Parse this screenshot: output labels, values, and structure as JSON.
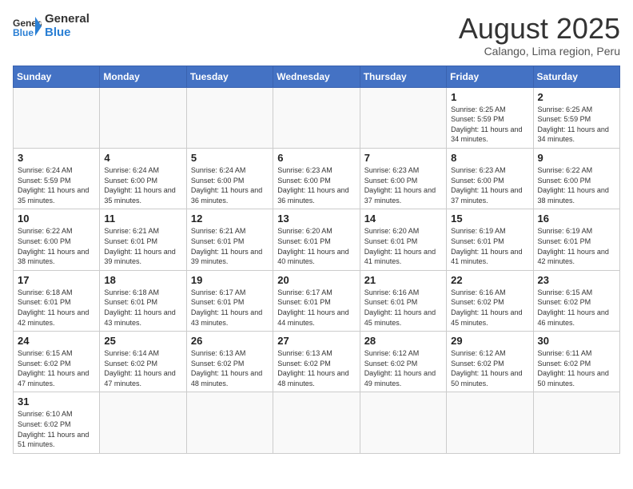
{
  "header": {
    "logo_general": "General",
    "logo_blue": "Blue",
    "month_title": "August 2025",
    "subtitle": "Calango, Lima region, Peru"
  },
  "weekdays": [
    "Sunday",
    "Monday",
    "Tuesday",
    "Wednesday",
    "Thursday",
    "Friday",
    "Saturday"
  ],
  "weeks": [
    [
      {
        "day": "",
        "info": ""
      },
      {
        "day": "",
        "info": ""
      },
      {
        "day": "",
        "info": ""
      },
      {
        "day": "",
        "info": ""
      },
      {
        "day": "",
        "info": ""
      },
      {
        "day": "1",
        "info": "Sunrise: 6:25 AM\nSunset: 5:59 PM\nDaylight: 11 hours and 34 minutes."
      },
      {
        "day": "2",
        "info": "Sunrise: 6:25 AM\nSunset: 5:59 PM\nDaylight: 11 hours and 34 minutes."
      }
    ],
    [
      {
        "day": "3",
        "info": "Sunrise: 6:24 AM\nSunset: 5:59 PM\nDaylight: 11 hours and 35 minutes."
      },
      {
        "day": "4",
        "info": "Sunrise: 6:24 AM\nSunset: 6:00 PM\nDaylight: 11 hours and 35 minutes."
      },
      {
        "day": "5",
        "info": "Sunrise: 6:24 AM\nSunset: 6:00 PM\nDaylight: 11 hours and 36 minutes."
      },
      {
        "day": "6",
        "info": "Sunrise: 6:23 AM\nSunset: 6:00 PM\nDaylight: 11 hours and 36 minutes."
      },
      {
        "day": "7",
        "info": "Sunrise: 6:23 AM\nSunset: 6:00 PM\nDaylight: 11 hours and 37 minutes."
      },
      {
        "day": "8",
        "info": "Sunrise: 6:23 AM\nSunset: 6:00 PM\nDaylight: 11 hours and 37 minutes."
      },
      {
        "day": "9",
        "info": "Sunrise: 6:22 AM\nSunset: 6:00 PM\nDaylight: 11 hours and 38 minutes."
      }
    ],
    [
      {
        "day": "10",
        "info": "Sunrise: 6:22 AM\nSunset: 6:00 PM\nDaylight: 11 hours and 38 minutes."
      },
      {
        "day": "11",
        "info": "Sunrise: 6:21 AM\nSunset: 6:01 PM\nDaylight: 11 hours and 39 minutes."
      },
      {
        "day": "12",
        "info": "Sunrise: 6:21 AM\nSunset: 6:01 PM\nDaylight: 11 hours and 39 minutes."
      },
      {
        "day": "13",
        "info": "Sunrise: 6:20 AM\nSunset: 6:01 PM\nDaylight: 11 hours and 40 minutes."
      },
      {
        "day": "14",
        "info": "Sunrise: 6:20 AM\nSunset: 6:01 PM\nDaylight: 11 hours and 41 minutes."
      },
      {
        "day": "15",
        "info": "Sunrise: 6:19 AM\nSunset: 6:01 PM\nDaylight: 11 hours and 41 minutes."
      },
      {
        "day": "16",
        "info": "Sunrise: 6:19 AM\nSunset: 6:01 PM\nDaylight: 11 hours and 42 minutes."
      }
    ],
    [
      {
        "day": "17",
        "info": "Sunrise: 6:18 AM\nSunset: 6:01 PM\nDaylight: 11 hours and 42 minutes."
      },
      {
        "day": "18",
        "info": "Sunrise: 6:18 AM\nSunset: 6:01 PM\nDaylight: 11 hours and 43 minutes."
      },
      {
        "day": "19",
        "info": "Sunrise: 6:17 AM\nSunset: 6:01 PM\nDaylight: 11 hours and 43 minutes."
      },
      {
        "day": "20",
        "info": "Sunrise: 6:17 AM\nSunset: 6:01 PM\nDaylight: 11 hours and 44 minutes."
      },
      {
        "day": "21",
        "info": "Sunrise: 6:16 AM\nSunset: 6:01 PM\nDaylight: 11 hours and 45 minutes."
      },
      {
        "day": "22",
        "info": "Sunrise: 6:16 AM\nSunset: 6:02 PM\nDaylight: 11 hours and 45 minutes."
      },
      {
        "day": "23",
        "info": "Sunrise: 6:15 AM\nSunset: 6:02 PM\nDaylight: 11 hours and 46 minutes."
      }
    ],
    [
      {
        "day": "24",
        "info": "Sunrise: 6:15 AM\nSunset: 6:02 PM\nDaylight: 11 hours and 47 minutes."
      },
      {
        "day": "25",
        "info": "Sunrise: 6:14 AM\nSunset: 6:02 PM\nDaylight: 11 hours and 47 minutes."
      },
      {
        "day": "26",
        "info": "Sunrise: 6:13 AM\nSunset: 6:02 PM\nDaylight: 11 hours and 48 minutes."
      },
      {
        "day": "27",
        "info": "Sunrise: 6:13 AM\nSunset: 6:02 PM\nDaylight: 11 hours and 48 minutes."
      },
      {
        "day": "28",
        "info": "Sunrise: 6:12 AM\nSunset: 6:02 PM\nDaylight: 11 hours and 49 minutes."
      },
      {
        "day": "29",
        "info": "Sunrise: 6:12 AM\nSunset: 6:02 PM\nDaylight: 11 hours and 50 minutes."
      },
      {
        "day": "30",
        "info": "Sunrise: 6:11 AM\nSunset: 6:02 PM\nDaylight: 11 hours and 50 minutes."
      }
    ],
    [
      {
        "day": "31",
        "info": "Sunrise: 6:10 AM\nSunset: 6:02 PM\nDaylight: 11 hours and 51 minutes."
      },
      {
        "day": "",
        "info": ""
      },
      {
        "day": "",
        "info": ""
      },
      {
        "day": "",
        "info": ""
      },
      {
        "day": "",
        "info": ""
      },
      {
        "day": "",
        "info": ""
      },
      {
        "day": "",
        "info": ""
      }
    ]
  ]
}
